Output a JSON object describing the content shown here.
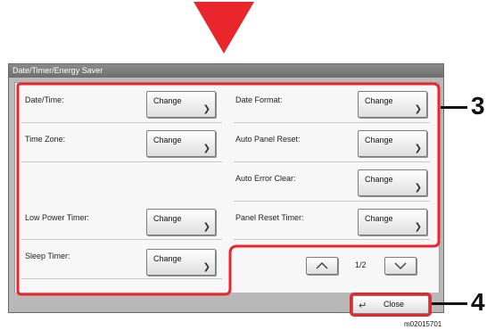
{
  "window": {
    "title": "Date/Timer/Energy Saver"
  },
  "settings": [
    {
      "label": "Date/Time:",
      "button": "Change"
    },
    {
      "label": "Date Format:",
      "button": "Change"
    },
    {
      "label": "Time Zone:",
      "button": "Change"
    },
    {
      "label": "Auto Panel Reset:",
      "button": "Change"
    },
    {
      "label": "Auto Error Clear:",
      "button": "Change"
    },
    {
      "label": "Low Power Timer:",
      "button": "Change"
    },
    {
      "label": "Panel Reset Timer:",
      "button": "Change"
    },
    {
      "label": "Sleep Timer:",
      "button": "Change"
    }
  ],
  "pagination": {
    "page": "1/2"
  },
  "footer": {
    "close_label": "Close"
  },
  "callouts": {
    "settings_number": "3",
    "close_number": "4"
  },
  "figure_code": "m02015701",
  "colors": {
    "highlight": "#e8262b",
    "arrow": "#e8262b"
  }
}
